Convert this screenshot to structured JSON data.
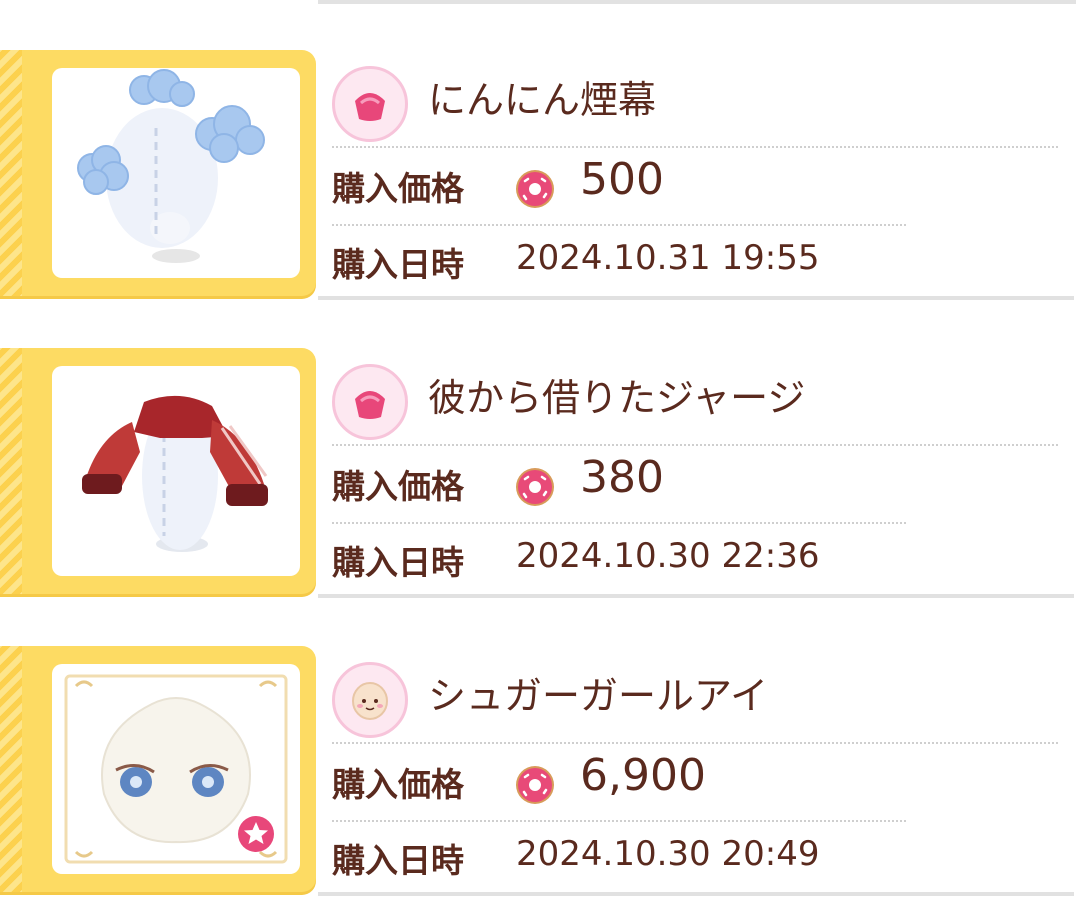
{
  "purchase_history": {
    "price_label": "購入価格",
    "date_label": "購入日時",
    "items": [
      {
        "name": "にんにん煙幕",
        "price": "500",
        "datetime": "2024.10.31 19:55",
        "category_icon": "outfit-category-icon",
        "thumbnail": "cloud-smoke-effect"
      },
      {
        "name": "彼から借りたジャージ",
        "price": "380",
        "datetime": "2024.10.30 22:36",
        "category_icon": "outfit-category-icon",
        "thumbnail": "red-track-jacket"
      },
      {
        "name": "シュガーガールアイ",
        "price": "6,900",
        "datetime": "2024.10.30 20:49",
        "category_icon": "face-category-icon",
        "thumbnail": "blue-eyes-face"
      }
    ]
  },
  "colors": {
    "accent_yellow": "#fddb63",
    "text_brown": "#5a2a1e",
    "badge_pink": "#fde8f1",
    "donut_pink": "#e84a78"
  }
}
